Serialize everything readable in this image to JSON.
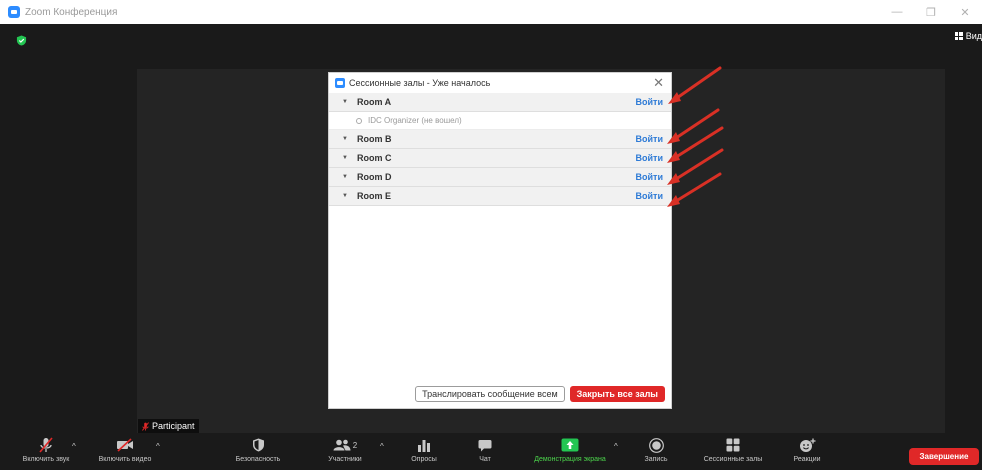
{
  "window": {
    "title": "Zoom Конференция",
    "controls": [
      "—",
      "❐",
      "✕"
    ]
  },
  "top_bar": {
    "view_label": "Вид"
  },
  "participant": {
    "name": "Participant"
  },
  "dialog": {
    "title": "Сессионные залы - Уже началось",
    "close_glyph": "✕",
    "chevron": "▼",
    "rooms": [
      {
        "name": "Room A",
        "join_label": "Войти",
        "members": [
          {
            "name": "IDC Organizer (не вошел)"
          }
        ]
      },
      {
        "name": "Room B",
        "join_label": "Войти",
        "members": []
      },
      {
        "name": "Room C",
        "join_label": "Войти",
        "members": []
      },
      {
        "name": "Room D",
        "join_label": "Войти",
        "members": []
      },
      {
        "name": "Room E",
        "join_label": "Войти",
        "members": []
      }
    ],
    "broadcast_label": "Транслировать сообщение всем",
    "close_all_label": "Закрыть все залы"
  },
  "toolbar": {
    "audio_label": "Включить звук",
    "video_label": "Включить видео",
    "security_label": "Безопасность",
    "participants_label": "Участники",
    "participants_count": "2",
    "polls_label": "Опросы",
    "chat_label": "Чат",
    "share_label": "Демонстрация экрана",
    "record_label": "Запись",
    "breakout_label": "Сессионные залы",
    "reactions_label": "Реакции",
    "caret": "^",
    "end_label": "Завершение"
  },
  "colors": {
    "accent_blue": "#2d8cff",
    "join_link": "#2d7ad6",
    "danger_red": "#e02828",
    "share_green": "#4cd44c",
    "annotation_arrow": "#d93025"
  }
}
